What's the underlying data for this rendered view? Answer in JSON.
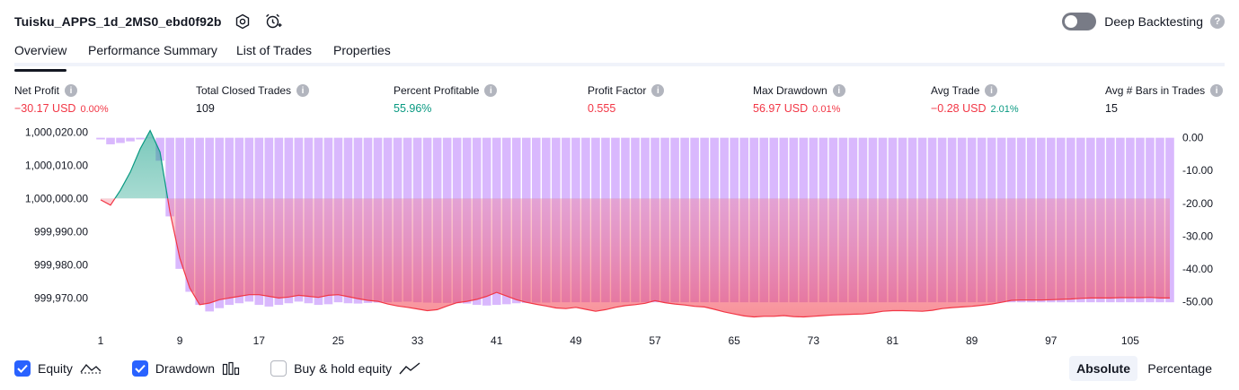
{
  "header": {
    "strategy_name": "Tuisku_APPS_1d_2MS0_ebd0f92b",
    "settings_icon": "settings-hexagon-icon",
    "alert_icon": "alarm-clock-plus-icon",
    "deep_backtesting_label": "Deep Backtesting",
    "deep_backtesting_enabled": false,
    "help_glyph": "?"
  },
  "tabs": [
    {
      "label": "Overview",
      "active": true
    },
    {
      "label": "Performance Summary",
      "active": false
    },
    {
      "label": "List of Trades",
      "active": false
    },
    {
      "label": "Properties",
      "active": false
    }
  ],
  "metrics": [
    {
      "label": "Net Profit",
      "value": "−30.17 USD",
      "sub": "0.00%",
      "tone": "neg",
      "sub_tone": "neg"
    },
    {
      "label": "Total Closed Trades",
      "value": "109",
      "sub": "",
      "tone": "plain",
      "sub_tone": "plain"
    },
    {
      "label": "Percent Profitable",
      "value": "55.96%",
      "sub": "",
      "tone": "pos",
      "sub_tone": "plain"
    },
    {
      "label": "Profit Factor",
      "value": "0.555",
      "sub": "",
      "tone": "neg",
      "sub_tone": "plain"
    },
    {
      "label": "Max Drawdown",
      "value": "56.97 USD",
      "sub": "0.01%",
      "tone": "neg",
      "sub_tone": "neg"
    },
    {
      "label": "Avg Trade",
      "value": "−0.28 USD",
      "sub": "2.01%",
      "tone": "neg",
      "sub_tone": "pos"
    },
    {
      "label": "Avg # Bars in Trades",
      "value": "15",
      "sub": "",
      "tone": "plain",
      "sub_tone": "plain"
    }
  ],
  "info_glyph": "i",
  "chart_data": {
    "type": "area",
    "left_axis": {
      "ticks": [
        "1,000,020.00",
        "1,000,010.00",
        "1,000,000.00",
        "999,990.00",
        "999,980.00",
        "999,970.00"
      ],
      "ylim": [
        999962,
        1000022
      ],
      "baseline": 1000000
    },
    "right_axis": {
      "ticks": [
        "0.00",
        "-10.00",
        "-20.00",
        "-30.00",
        "-40.00",
        "-50.00"
      ],
      "ylim": [
        -57,
        1
      ]
    },
    "x_ticks": [
      "1",
      "9",
      "17",
      "25",
      "33",
      "41",
      "49",
      "57",
      "65",
      "73",
      "81",
      "89",
      "97",
      "105"
    ],
    "x_range": [
      1,
      109
    ],
    "equity": [
      [
        1,
        999999.6
      ],
      [
        2,
        999998.0
      ],
      [
        3,
        1000002.5
      ],
      [
        4,
        1000008.0
      ],
      [
        5,
        1000015.0
      ],
      [
        6,
        1000020.5
      ],
      [
        7,
        1000014.0
      ],
      [
        8,
        999996.0
      ],
      [
        9,
        999982.0
      ],
      [
        10,
        999973.0
      ],
      [
        11,
        999968.0
      ],
      [
        12,
        999968.5
      ],
      [
        13,
        999969.5
      ],
      [
        14,
        999970.0
      ],
      [
        15,
        999970.5
      ],
      [
        16,
        999971.0
      ],
      [
        17,
        999971.0
      ],
      [
        18,
        999970.5
      ],
      [
        19,
        999970.0
      ],
      [
        20,
        999970.3
      ],
      [
        21,
        999970.8
      ],
      [
        22,
        999970.5
      ],
      [
        23,
        999970.2
      ],
      [
        24,
        999970.8
      ],
      [
        25,
        999971.0
      ],
      [
        26,
        999970.4
      ],
      [
        27,
        999969.8
      ],
      [
        28,
        999969.3
      ],
      [
        29,
        999969.0
      ],
      [
        30,
        999968.2
      ],
      [
        31,
        999967.6
      ],
      [
        32,
        999967.2
      ],
      [
        33,
        999966.7
      ],
      [
        34,
        999966.2
      ],
      [
        35,
        999966.5
      ],
      [
        36,
        999967.6
      ],
      [
        37,
        999968.6
      ],
      [
        38,
        999969.0
      ],
      [
        39,
        999969.6
      ],
      [
        40,
        999970.5
      ],
      [
        41,
        999971.7
      ],
      [
        42,
        999970.6
      ],
      [
        43,
        999969.5
      ],
      [
        44,
        999968.7
      ],
      [
        45,
        999968.1
      ],
      [
        46,
        999967.6
      ],
      [
        47,
        999967.0
      ],
      [
        48,
        999966.8
      ],
      [
        49,
        999967.2
      ],
      [
        50,
        999966.6
      ],
      [
        51,
        999966.0
      ],
      [
        52,
        999966.5
      ],
      [
        53,
        999967.2
      ],
      [
        54,
        999967.7
      ],
      [
        55,
        999968.0
      ],
      [
        56,
        999968.4
      ],
      [
        57,
        999969.2
      ],
      [
        58,
        999968.6
      ],
      [
        59,
        999968.2
      ],
      [
        60,
        999967.9
      ],
      [
        61,
        999967.5
      ],
      [
        62,
        999967.3
      ],
      [
        63,
        999966.6
      ],
      [
        64,
        999965.8
      ],
      [
        65,
        999965.2
      ],
      [
        66,
        999964.6
      ],
      [
        67,
        999964.3
      ],
      [
        68,
        999964.5
      ],
      [
        69,
        999964.5
      ],
      [
        70,
        999964.7
      ],
      [
        71,
        999964.4
      ],
      [
        72,
        999964.3
      ],
      [
        73,
        999964.5
      ],
      [
        74,
        999964.7
      ],
      [
        75,
        999964.9
      ],
      [
        76,
        999965.0
      ],
      [
        77,
        999965.1
      ],
      [
        78,
        999965.2
      ],
      [
        79,
        999965.5
      ],
      [
        80,
        999966.0
      ],
      [
        81,
        999966.2
      ],
      [
        82,
        999966.2
      ],
      [
        83,
        999966.1
      ],
      [
        84,
        999966.0
      ],
      [
        85,
        999966.3
      ],
      [
        86,
        999966.8
      ],
      [
        87,
        999967.1
      ],
      [
        88,
        999967.3
      ],
      [
        89,
        999967.5
      ],
      [
        90,
        999967.8
      ],
      [
        91,
        999968.2
      ],
      [
        92,
        999968.7
      ],
      [
        93,
        999969.3
      ],
      [
        94,
        999969.4
      ],
      [
        95,
        999969.4
      ],
      [
        96,
        999969.4
      ],
      [
        97,
        999969.5
      ],
      [
        98,
        999969.6
      ],
      [
        99,
        999969.7
      ],
      [
        100,
        999969.9
      ],
      [
        101,
        999970.0
      ],
      [
        102,
        999970.0
      ],
      [
        103,
        999970.0
      ],
      [
        104,
        999970.1
      ],
      [
        105,
        999970.1
      ],
      [
        106,
        999970.1
      ],
      [
        107,
        999970.2
      ],
      [
        108,
        999970.0
      ],
      [
        109,
        999970.0
      ]
    ],
    "drawdown": [
      -0.5,
      -2.0,
      -1.6,
      -1.1,
      -0.5,
      0.0,
      -7.0,
      -24.0,
      -40.0,
      -47.0,
      -51.0,
      -53.0,
      -52.0,
      -51.0,
      -50.5,
      -50.0,
      -51.0,
      -51.5,
      -51.0,
      -50.5,
      -50.0,
      -50.5,
      -51.0,
      -50.8,
      -50.2,
      -50.5,
      -50.6,
      -50.4,
      -50.3,
      -50.2,
      -50.1,
      -50.0,
      -50.2,
      -50.3,
      -50.4,
      -50.4,
      -50.5,
      -50.6,
      -51.0,
      -51.2,
      -51.0,
      -50.8,
      -50.5,
      -50.4,
      -50.3,
      -50.3,
      -50.2,
      -50.2,
      -50.2,
      -50.2,
      -50.2,
      -50.2,
      -50.2,
      -50.2,
      -50.2,
      -50.2,
      -50.2,
      -50.2,
      -50.2,
      -50.2,
      -50.2,
      -50.2,
      -50.2,
      -50.2,
      -50.2,
      -50.2,
      -50.2,
      -50.2,
      -50.2,
      -50.2,
      -50.2,
      -50.2,
      -50.2,
      -50.2,
      -50.2,
      -50.2,
      -50.2,
      -50.2,
      -50.2,
      -50.2,
      -50.2,
      -50.2,
      -50.2,
      -50.2,
      -50.2,
      -50.2,
      -50.2,
      -50.2,
      -50.2,
      -50.2,
      -50.2,
      -50.2,
      -50.2,
      -50.2,
      -50.2,
      -50.2,
      -50.2,
      -50.2,
      -50.2,
      -50.2,
      -50.2,
      -50.2,
      -50.2,
      -50.2,
      -50.2,
      -50.2,
      -50.2,
      -50.2,
      -50.2
    ],
    "colors": {
      "equity_gain_line": "#089981",
      "equity_loss_line": "#f23645",
      "equity_gain_fill": "#b7e4d7",
      "equity_loss_fill": "#f7a3b5",
      "drawdown_bar": "#d9b8fd"
    }
  },
  "legend": [
    {
      "label": "Equity",
      "checked": true,
      "icon": "equity-area-icon"
    },
    {
      "label": "Drawdown",
      "checked": true,
      "icon": "drawdown-bars-icon"
    },
    {
      "label": "Buy & hold equity",
      "checked": false,
      "icon": "buy-hold-line-icon"
    }
  ],
  "modes": [
    {
      "label": "Absolute",
      "active": true
    },
    {
      "label": "Percentage",
      "active": false
    }
  ]
}
